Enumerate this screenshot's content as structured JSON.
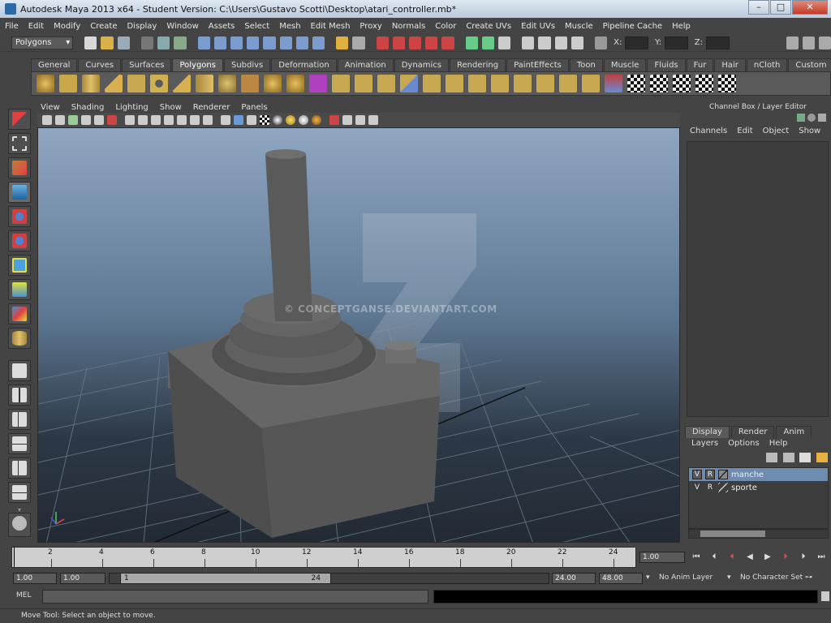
{
  "window": {
    "title": "Autodesk Maya 2013 x64 - Student Version: C:\\Users\\Gustavo Scotti\\Desktop\\atari_controller.mb*",
    "minimize": "–",
    "maximize": "□",
    "close": "✕"
  },
  "menubar": [
    "File",
    "Edit",
    "Modify",
    "Create",
    "Display",
    "Window",
    "Assets",
    "Select",
    "Mesh",
    "Edit Mesh",
    "Proxy",
    "Normals",
    "Color",
    "Create UVs",
    "Edit UVs",
    "Muscle",
    "Pipeline Cache",
    "Help"
  ],
  "statusline": {
    "mode": "Polygons",
    "x_label": "X:",
    "y_label": "Y:",
    "z_label": "Z:"
  },
  "shelf": {
    "tabs": [
      "General",
      "Curves",
      "Surfaces",
      "Polygons",
      "Subdivs",
      "Deformation",
      "Animation",
      "Dynamics",
      "Rendering",
      "PaintEffects",
      "Toon",
      "Muscle",
      "Fluids",
      "Fur",
      "Hair",
      "nCloth",
      "Custom"
    ],
    "active_tab": "Polygons"
  },
  "panel": {
    "menus": [
      "View",
      "Shading",
      "Lighting",
      "Show",
      "Renderer",
      "Panels"
    ],
    "watermark": "© CONCEPTGANSE.DEVIANTART.COM"
  },
  "channelbox": {
    "title": "Channel Box / Layer Editor",
    "menus": [
      "Channels",
      "Edit",
      "Object",
      "Show"
    ]
  },
  "layers": {
    "tabs": [
      "Display",
      "Render",
      "Anim"
    ],
    "active_tab": "Display",
    "menus": [
      "Layers",
      "Options",
      "Help"
    ],
    "rows": [
      {
        "v": "V",
        "r": "R",
        "name": "manche",
        "selected": true
      },
      {
        "v": "V",
        "r": "R",
        "name": "sporte",
        "selected": false
      }
    ]
  },
  "timeline": {
    "ticks": [
      "2",
      "4",
      "6",
      "8",
      "10",
      "12",
      "14",
      "16",
      "18",
      "20",
      "22",
      "24"
    ],
    "current_frame": "1.00"
  },
  "range": {
    "start": "1.00",
    "anim_start": "1.00",
    "slider_start": "1",
    "slider_end": "24",
    "anim_end": "24.00",
    "end": "48.00",
    "anim_layer": "No Anim Layer",
    "character_set": "No Character Set"
  },
  "command": {
    "label": "MEL"
  },
  "helpline": "Move Tool: Select an object to move."
}
